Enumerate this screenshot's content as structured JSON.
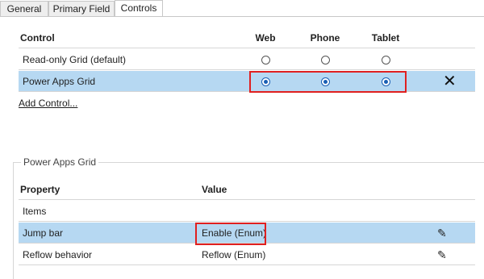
{
  "tabs": [
    {
      "label": "General",
      "active": false
    },
    {
      "label": "Primary Field",
      "active": false
    },
    {
      "label": "Controls",
      "active": true
    }
  ],
  "controls": {
    "headers": {
      "control": "Control",
      "web": "Web",
      "phone": "Phone",
      "tablet": "Tablet"
    },
    "rows": [
      {
        "name": "Read-only Grid (default)",
        "web": false,
        "phone": false,
        "tablet": false,
        "selected": false
      },
      {
        "name": "Power Apps Grid",
        "web": true,
        "phone": true,
        "tablet": true,
        "selected": true
      }
    ],
    "remove_icon": "close-icon",
    "add_link": "Add Control..."
  },
  "properties": {
    "group_title": "Power Apps Grid",
    "headers": {
      "property": "Property",
      "value": "Value"
    },
    "rows": [
      {
        "name": "Items",
        "value": "",
        "editable": false,
        "selected": false
      },
      {
        "name": "Jump bar",
        "value": "Enable (Enum)",
        "editable": true,
        "selected": true
      },
      {
        "name": "Reflow behavior",
        "value": "Reflow (Enum)",
        "editable": true,
        "selected": false
      }
    ],
    "edit_icon": "pencil-icon"
  },
  "colors": {
    "selection": "#b6d8f2",
    "highlight_box": "#e02020",
    "radio_checked": "#1a5fb4"
  }
}
